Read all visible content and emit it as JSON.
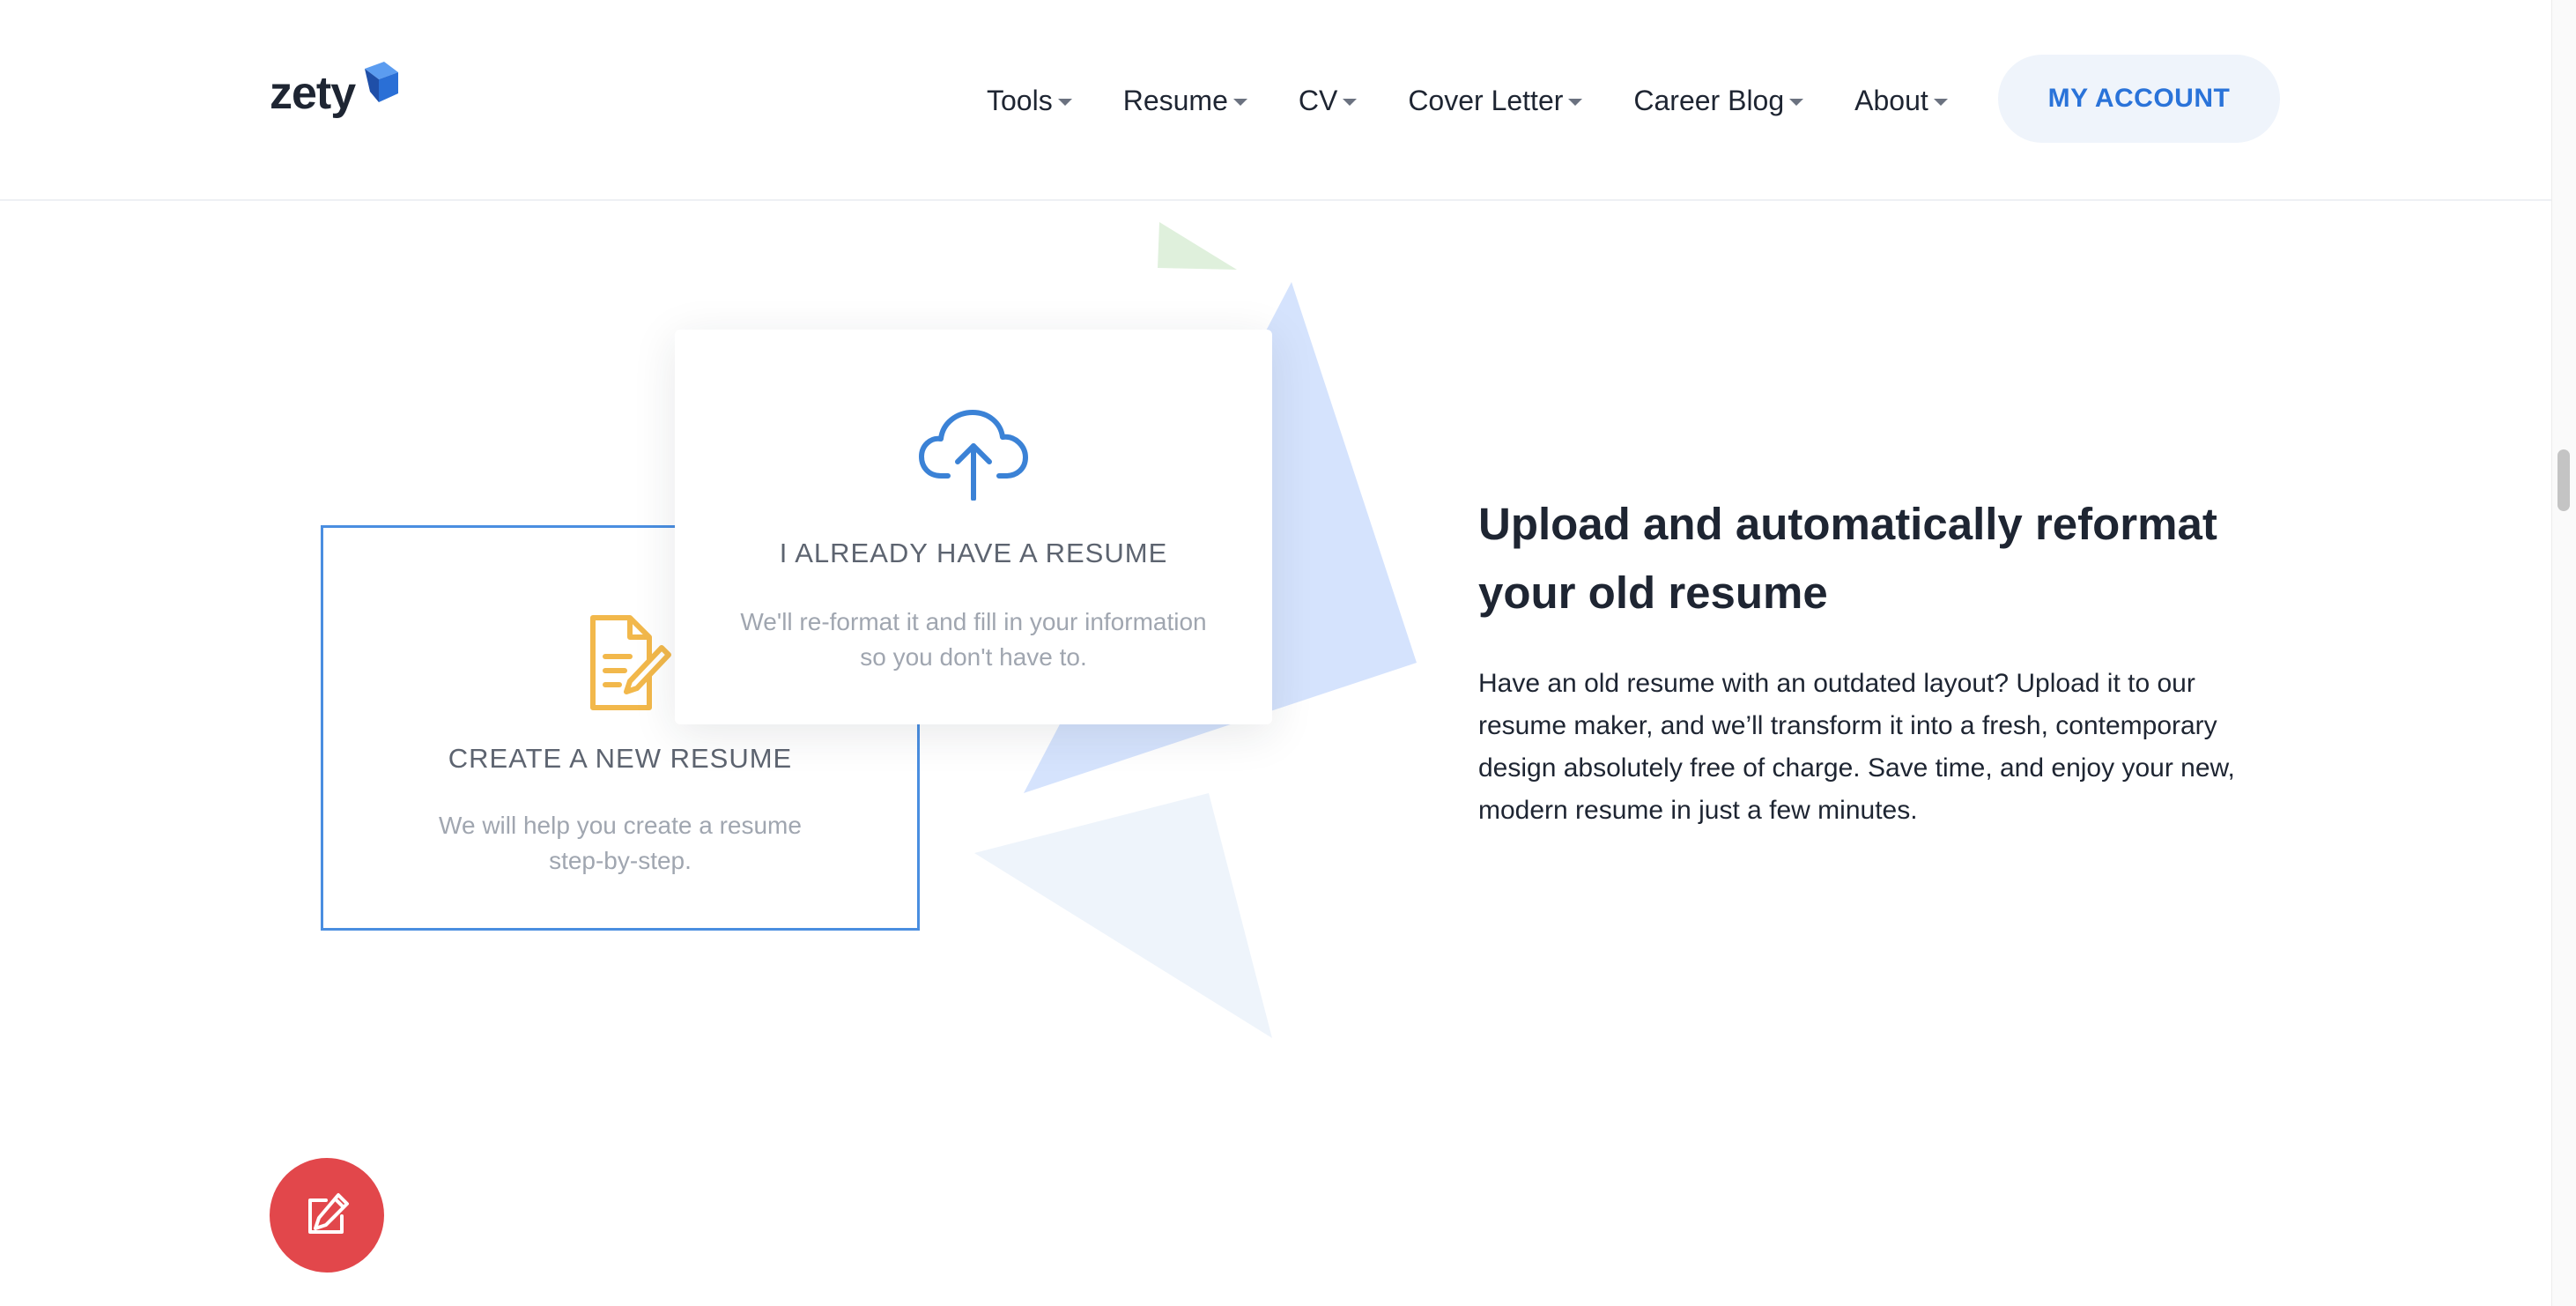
{
  "header": {
    "logo_text": "zety",
    "nav": [
      {
        "label": "Tools"
      },
      {
        "label": "Resume"
      },
      {
        "label": "CV"
      },
      {
        "label": "Cover Letter"
      },
      {
        "label": "Career Blog"
      },
      {
        "label": "About"
      }
    ],
    "account_label": "MY ACCOUNT"
  },
  "cards": {
    "upload": {
      "title": "I ALREADY HAVE A RESUME",
      "desc_line1": "We'll re-format it and fill in your information",
      "desc_line2": "so you don't have to."
    },
    "create": {
      "title": "CREATE A NEW RESUME",
      "desc_line1": "We will help you create a resume",
      "desc_line2": "step-by-step."
    }
  },
  "content": {
    "headline_line1": "Upload and automatically reformat",
    "headline_line2": "your old resume",
    "paragraph_line1": "Have an old resume with an outdated layout? Upload it to our",
    "paragraph_line2": "resume maker, and we’ll transform it into a fresh, contemporary",
    "paragraph_line3": "design absolutely free of charge. Save time, and enjoy your new,",
    "paragraph_line4": "modern resume in just a few minutes."
  },
  "icons": {
    "upload": "cloud-upload-icon",
    "create": "document-edit-icon",
    "fab": "edit-icon"
  },
  "colors": {
    "accent": "#2a73d9",
    "fab": "#e2474b",
    "create_icon": "#f2b84b",
    "upload_icon": "#3b82d6"
  }
}
